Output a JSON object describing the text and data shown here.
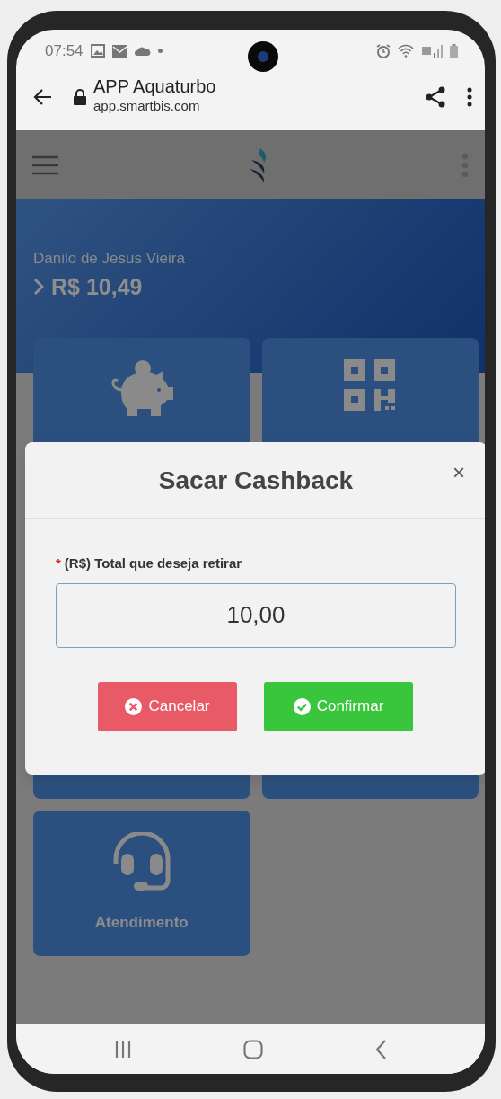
{
  "status_bar": {
    "time": "07:54"
  },
  "browser": {
    "title": "APP Aquaturbo",
    "url": "app.smartbis.com"
  },
  "account": {
    "name": "Danilo de Jesus Vieira",
    "balance": "R$ 10,49"
  },
  "tiles": [
    {
      "kind": "piggy"
    },
    {
      "kind": "qr"
    },
    {
      "kind": "plain"
    },
    {
      "kind": "plain"
    },
    {
      "kind": "headset",
      "label": "Atendimento"
    }
  ],
  "modal": {
    "title": "Sacar Cashback",
    "close": "×",
    "field": {
      "required_mark": "*",
      "label": "(R$) Total que deseja retirar",
      "value": "10,00"
    },
    "buttons": [
      {
        "kind": "cancel",
        "label": "Cancelar"
      },
      {
        "kind": "confirm",
        "label": "Confirmar"
      }
    ]
  }
}
